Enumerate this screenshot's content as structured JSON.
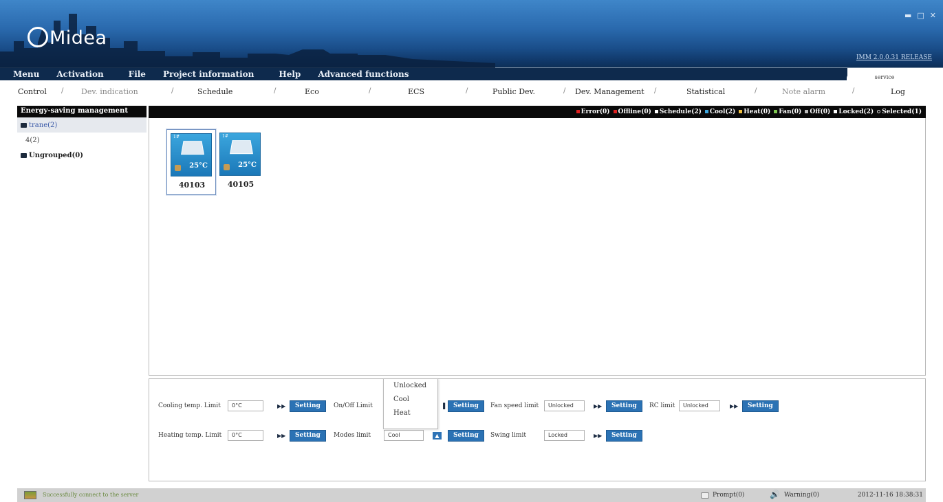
{
  "app": {
    "brand": "Midea",
    "version": "IMM 2.0.0.31 RELEASE",
    "service_tab": "service"
  },
  "menu": [
    "Menu",
    "Activation",
    "File",
    "Project information",
    "Help",
    "Advanced functions"
  ],
  "nav_tabs": [
    {
      "label": "Control",
      "dim": false
    },
    {
      "label": "Dev. indication",
      "dim": true
    },
    {
      "label": "Schedule",
      "dim": false
    },
    {
      "label": "Eco",
      "dim": false
    },
    {
      "label": "ECS",
      "dim": false
    },
    {
      "label": "Public Dev.",
      "dim": false
    },
    {
      "label": "Dev. Management",
      "dim": false
    },
    {
      "label": "Statistical",
      "dim": false
    },
    {
      "label": "Note alarm",
      "dim": true
    },
    {
      "label": "Log",
      "dim": false
    }
  ],
  "sidebar": {
    "title": "Energy-saving management",
    "items": [
      {
        "label": "trane(2)",
        "selected": true
      },
      {
        "label": "4(2)"
      },
      {
        "label": "Ungrouped(0)"
      }
    ]
  },
  "legend": [
    {
      "label": "Error(0)",
      "color": "#e02020"
    },
    {
      "label": "Offline(0)",
      "color": "#e02020"
    },
    {
      "label": "Schedule(2)",
      "color": "#ffffff"
    },
    {
      "label": "Cool(2)",
      "color": "#3ba6de"
    },
    {
      "label": "Heat(0)",
      "color": "#f0c040"
    },
    {
      "label": "Fan(0)",
      "color": "#7ec850"
    },
    {
      "label": "Off(0)",
      "color": "#bbbbbb"
    },
    {
      "label": "Locked(2)",
      "color": "#ffffff"
    },
    {
      "label": "Selected(1)",
      "color": "#dddddd"
    }
  ],
  "devices": [
    {
      "name": "40103",
      "temp": "25°C",
      "num": "1#"
    },
    {
      "name": "40105",
      "temp": "25°C",
      "num": "1#"
    }
  ],
  "controls": {
    "cooling_label": "Cooling temp. Limit",
    "cooling_value": "0°C",
    "heating_label": "Heating temp. Limit",
    "heating_value": "0°C",
    "onoff_label": "On/Off Limit",
    "modes_label": "Modes limit",
    "modes_value": "Cool",
    "fan_label": "Fan speed limit",
    "fan_value": "Unlocked",
    "swing_label": "Swing limit",
    "swing_value": "Locked",
    "rc_label": "RC limit",
    "rc_value": "Unlocked",
    "setting": "Setting"
  },
  "dropdown": [
    "Unlocked",
    "Cool",
    "Heat"
  ],
  "status": {
    "message": "Successfully connect to the server",
    "prompt": "Prompt(0)",
    "warning": "Warning(0)",
    "time": "2012-11-16 18:38:31"
  }
}
